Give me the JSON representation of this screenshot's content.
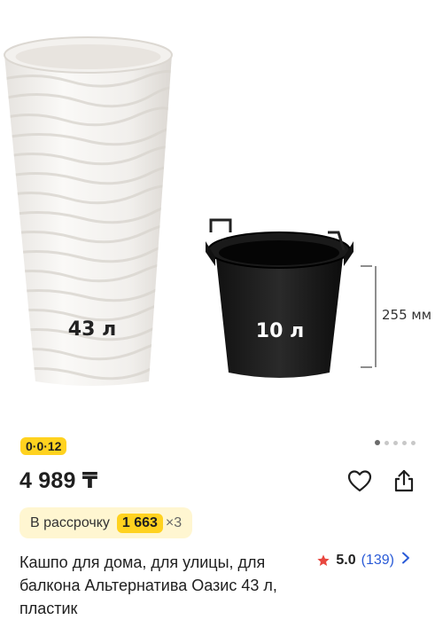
{
  "gallery": {
    "vase_volume_label": "43 л",
    "pot_volume_label": "10 л",
    "height_label": "255 мм",
    "slide_count": 5,
    "active_slide": 1
  },
  "badge": {
    "text": "0·0·12"
  },
  "price": {
    "text": "4 989 ₸"
  },
  "actions": {
    "favorite_icon": "heart-icon",
    "share_icon": "share-icon"
  },
  "installment": {
    "label": "В рассрочку",
    "amount": "1 663",
    "multiplier": "×3"
  },
  "product": {
    "title": "Кашпо для дома, для улицы, для балкона Альтернатива Оазис 43 л, пластик"
  },
  "rating": {
    "icon": "star-icon",
    "value": "5.0",
    "count": "(139)"
  },
  "colors": {
    "accent_yellow": "#ffd21f",
    "installment_bg": "#fff6d1",
    "link_blue": "#2a5bd7",
    "star_red": "#e8473f"
  }
}
